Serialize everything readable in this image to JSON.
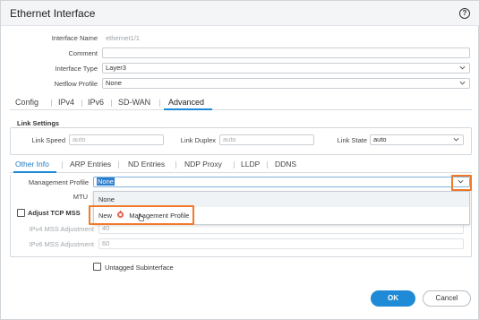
{
  "window": {
    "title": "Ethernet Interface",
    "help_icon": "help-icon"
  },
  "form": {
    "interface_name_label": "Interface Name",
    "interface_name_value": "ethernet1/1",
    "comment_label": "Comment",
    "comment_value": "",
    "interface_type_label": "Interface Type",
    "interface_type_value": "Layer3",
    "netflow_profile_label": "Netflow Profile",
    "netflow_profile_value": "None"
  },
  "tabs": [
    {
      "label": "Config"
    },
    {
      "label": "IPv4"
    },
    {
      "label": "IPv6"
    },
    {
      "label": "SD-WAN"
    },
    {
      "label": "Advanced",
      "active": true
    }
  ],
  "link_settings": {
    "title": "Link Settings",
    "link_speed_label": "Link Speed",
    "link_speed_value": "auto",
    "link_duplex_label": "Link Duplex",
    "link_duplex_value": "auto",
    "link_state_label": "Link State",
    "link_state_value": "auto"
  },
  "subtabs": [
    {
      "label": "Other Info",
      "active": true
    },
    {
      "label": "ARP Entries"
    },
    {
      "label": "ND Entries"
    },
    {
      "label": "NDP Proxy"
    },
    {
      "label": "LLDP"
    },
    {
      "label": "DDNS"
    }
  ],
  "other_info": {
    "management_profile_label": "Management Profile",
    "management_profile_value": "None",
    "dropdown_options": [
      "None",
      "New"
    ],
    "new_profile_link": "Management Profile",
    "mtu_label": "MTU",
    "adjust_tcp_mss_label": "Adjust TCP MSS",
    "ipv4_mss_label": "IPv4 MSS Adjustment",
    "ipv4_mss_value": "40",
    "ipv6_mss_label": "IPv6 MSS Adjustment",
    "ipv6_mss_value": "60",
    "untagged_subinterface_label": "Untagged Subinterface"
  },
  "buttons": {
    "ok": "OK",
    "cancel": "Cancel"
  },
  "colors": {
    "accent": "#1f8ad6",
    "highlight": "#f07a2a"
  }
}
